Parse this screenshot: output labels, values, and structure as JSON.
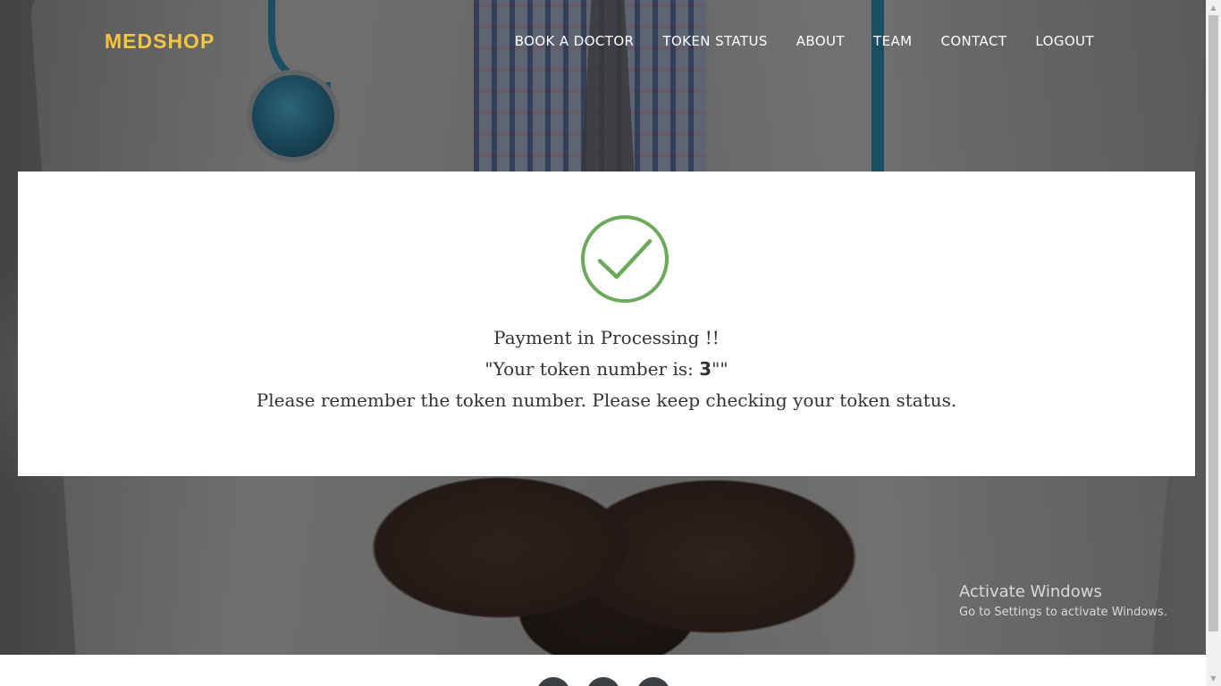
{
  "brand": "MEDSHOP",
  "nav": [
    {
      "label": "BOOK A DOCTOR"
    },
    {
      "label": "TOKEN STATUS"
    },
    {
      "label": "ABOUT"
    },
    {
      "label": "TEAM"
    },
    {
      "label": "CONTACT"
    },
    {
      "label": "LOGOUT"
    }
  ],
  "message": {
    "line1": "Payment in Processing !!",
    "token_prefix": "\"Your token number is: ",
    "token_number": "3",
    "token_suffix": "\"\"",
    "line3": "Please remember the token number. Please keep checking your token status."
  },
  "watermark": {
    "title": "Activate Windows",
    "subtitle": "Go to Settings to activate Windows."
  },
  "colors": {
    "brand": "#f5c542",
    "check": "#6aaa5a"
  },
  "icons": {
    "success": "check-circle-icon"
  }
}
